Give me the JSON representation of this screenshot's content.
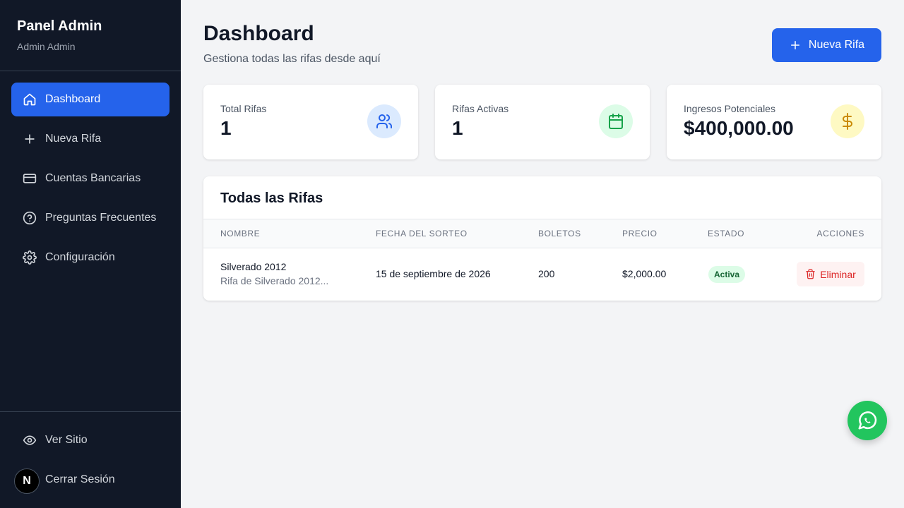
{
  "sidebar": {
    "title": "Panel Admin",
    "subtitle": "Admin Admin",
    "items": [
      {
        "label": "Dashboard",
        "icon": "home-icon",
        "active": true
      },
      {
        "label": "Nueva Rifa",
        "icon": "plus-icon"
      },
      {
        "label": "Cuentas Bancarias",
        "icon": "credit-card-icon"
      },
      {
        "label": "Preguntas Frecuentes",
        "icon": "help-circle-icon"
      },
      {
        "label": "Configuración",
        "icon": "gear-icon"
      }
    ],
    "bottom_items": [
      {
        "label": "Ver Sitio",
        "icon": "eye-icon"
      },
      {
        "label": "Cerrar Sesión",
        "icon": "logout-icon"
      }
    ],
    "badge_letter": "N"
  },
  "header": {
    "title": "Dashboard",
    "subtitle": "Gestiona todas las rifas desde aquí",
    "primary_button": "Nueva Rifa"
  },
  "stats": [
    {
      "label": "Total Rifas",
      "value": "1",
      "icon": "users-icon",
      "icon_bg": "#dbeafe",
      "icon_color": "#2563eb"
    },
    {
      "label": "Rifas Activas",
      "value": "1",
      "icon": "calendar-icon",
      "icon_bg": "#dcfce7",
      "icon_color": "#16a34a"
    },
    {
      "label": "Ingresos Potenciales",
      "value": "$400,000.00",
      "icon": "dollar-icon",
      "icon_bg": "#fef9c3",
      "icon_color": "#ca8a04"
    }
  ],
  "table": {
    "title": "Todas las Rifas",
    "columns": [
      "Nombre",
      "Fecha del Sorteo",
      "Boletos",
      "Precio",
      "Estado",
      "Acciones"
    ],
    "rows": [
      {
        "name": "Silverado 2012",
        "description": "Rifa de Silverado 2012...",
        "date": "15 de septiembre de 2026",
        "tickets": "200",
        "price": "$2,000.00",
        "status": "Activa",
        "action": "Eliminar"
      }
    ]
  },
  "colors": {
    "sidebar_bg": "#111827",
    "accent": "#2563eb",
    "whatsapp": "#22c55e",
    "danger": "#dc2626"
  }
}
